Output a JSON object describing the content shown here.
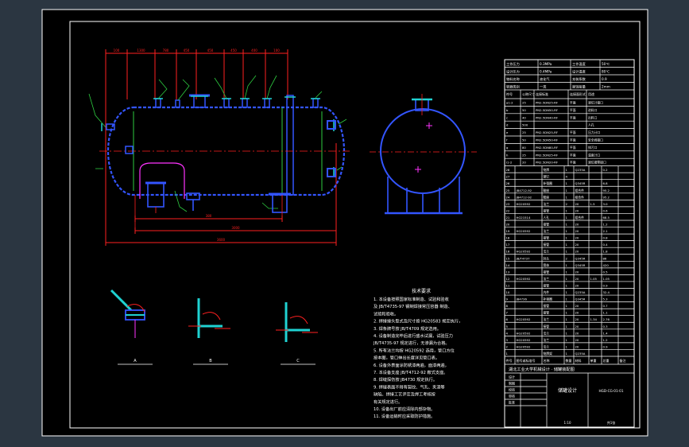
{
  "colors": {
    "viewport_bg": "#2b3641",
    "sheet_bg": "#000000",
    "frame": "#ffffff",
    "vessel": "#3355ff",
    "dimension": "#ff2020",
    "nozzle": "#1fd2d2",
    "leader": "#2ecc40",
    "magenta": "#ff33ff",
    "text": "#ffffff"
  },
  "drawing": {
    "plan_dims": [
      "100",
      "1300",
      "780",
      "450",
      "450",
      "450",
      "400",
      "100"
    ],
    "plan_bottom_dims": [
      "380",
      "3000",
      "3600"
    ],
    "detail_captions": [
      "A",
      "B",
      "C"
    ],
    "detail_titles": [
      "",
      "",
      ""
    ]
  },
  "notes": {
    "title": "技术要求",
    "lines": [
      "1. 本设备按照国家标准制造、试验和验收",
      "及 JB/T4735-97 钢制焊接常压容器 制造、",
      "试验和验收。",
      "2. 焊接接头型式及尺寸按 HG20583 规定执行，",
      "3. 焊条牌号按 JB/T4709 规定选用。",
      "4. 设备制造完毕后进行盛水试漏，试验压力",
      "JB/T4735-97 规定进行，无渗漏为合格。",
      "5. 所有法兰均按 HG20592 选用，管口方位",
      "按本图，管口伸出长度详见管口表。",
      "6. 设备外表面涂防锈漆两遍，面漆两遍，",
      "7. 本设备支座 JB/T4712-92 鞍式支座。",
      "8. 焊缝探伤按 JB4730 规定执行。",
      "9. 焊缝表面不得有裂纹、气孔、夹渣等",
      "缺陷。焊接工艺评定及焊工考核按",
      "有关规定进行。",
      "10. 设备出厂前应清除内部杂物。",
      "11. 设备运输时应采取防护措施。"
    ]
  },
  "spec_table": {
    "rows": [
      [
        "工作压力",
        "0.3MPa",
        "工作温度",
        "50℃"
      ],
      [
        "设计压力",
        "0.4MPa",
        "设计温度",
        "80℃"
      ],
      [
        "物料名称",
        "液化气",
        "充装系数",
        "0.9"
      ],
      [
        "容器类别",
        "一类",
        "腐蚀裕量",
        "2mm"
      ]
    ]
  },
  "nozzle_table": {
    "headers": [
      "符号",
      "公称尺寸",
      "连接标准",
      "连接面形式",
      "用途"
    ],
    "rows": [
      [
        "a1-2",
        "25",
        "PN2.5DN25-RF",
        "平面",
        "液位计接口"
      ],
      [
        "b",
        "50",
        "PN2.5DN50-RF",
        "平面",
        "进料口"
      ],
      [
        "c",
        "40",
        "PN2.5DN40-RF",
        "平面",
        "出料口"
      ],
      [
        "d",
        "500",
        "",
        "",
        "人孔"
      ],
      [
        "e",
        "25",
        "PN2.5DN25-RF",
        "平面",
        "压力计口"
      ],
      [
        "f",
        "50",
        "PN2.5DN50-RF",
        "平面",
        "安全阀接口"
      ],
      [
        "g",
        "80",
        "PN2.5DN80-RF",
        "平面",
        "排污口"
      ],
      [
        "h",
        "25",
        "PN2.5DN25-RF",
        "平面",
        "温度计口"
      ],
      [
        "i1-2",
        "20",
        "PN2.5DN20-RF",
        "平面",
        "液位报警接口"
      ]
    ]
  },
  "bom": {
    "rows": [
      [
        "28",
        "",
        "铭牌",
        "1",
        "Q235A",
        "",
        "0.2",
        ""
      ],
      [
        "27",
        "",
        "铆钉",
        "4",
        "",
        "",
        "",
        ""
      ],
      [
        "26",
        "",
        "补强圈",
        "1",
        "Q345R",
        "",
        "6.8",
        ""
      ],
      [
        "25",
        "JB4712-92",
        "鞍座",
        "1",
        "组合件",
        "",
        "95.2",
        ""
      ],
      [
        "24",
        "JB4712-92",
        "鞍座",
        "1",
        "组合件",
        "",
        "95.2",
        ""
      ],
      [
        "23",
        "HG20592",
        "法兰",
        "2",
        "20",
        "1.5",
        "3.0",
        ""
      ],
      [
        "22",
        "",
        "接管",
        "1",
        "20",
        "",
        "0.6",
        ""
      ],
      [
        "21",
        "HG21514",
        "人孔",
        "1",
        "组合件",
        "",
        "68.5",
        ""
      ],
      [
        "20",
        "",
        "接管",
        "1",
        "20",
        "",
        "1.2",
        ""
      ],
      [
        "19",
        "HG20592",
        "法兰",
        "1",
        "20",
        "",
        "2.1",
        ""
      ],
      [
        "18",
        "",
        "接管",
        "1",
        "20",
        "",
        "0.8",
        ""
      ],
      [
        "17",
        "",
        "接管",
        "1",
        "20",
        "",
        "0.4",
        ""
      ],
      [
        "16",
        "HG20592",
        "法兰",
        "1",
        "20",
        "",
        "1.8",
        ""
      ],
      [
        "15",
        "JB/T4737",
        "封头",
        "2",
        "Q345R",
        "",
        "86",
        ""
      ],
      [
        "14",
        "",
        "筒体",
        "1",
        "Q345R",
        "",
        "420",
        ""
      ],
      [
        "13",
        "",
        "接管",
        "1",
        "20",
        "",
        "0.5",
        ""
      ],
      [
        "12",
        "HG20592",
        "法兰",
        "1",
        "20",
        "1.05",
        "1.05",
        ""
      ],
      [
        "11",
        "",
        "接管",
        "1",
        "20",
        "",
        "0.9",
        ""
      ],
      [
        "10",
        "",
        "内件",
        "1",
        "Q235A",
        "",
        "32.4",
        ""
      ],
      [
        "9",
        "JB4736",
        "补强圈",
        "1",
        "Q345R",
        "",
        "5.3",
        ""
      ],
      [
        "8",
        "",
        "接管",
        "1",
        "20",
        "",
        "0.7",
        ""
      ],
      [
        "7",
        "",
        "接管",
        "1",
        "20",
        "",
        "1.1",
        ""
      ],
      [
        "6",
        "HG20592",
        "法兰",
        "1",
        "20",
        "1.34",
        "2.76",
        ""
      ],
      [
        "5",
        "",
        "接管",
        "1",
        "20",
        "",
        "0.3",
        ""
      ],
      [
        "4",
        "HG20592",
        "法兰",
        "1",
        "20",
        "",
        "1.4",
        ""
      ],
      [
        "3",
        "HG20592",
        "法兰",
        "1",
        "20",
        "",
        "1.2",
        ""
      ],
      [
        "2",
        "HG20592",
        "法兰",
        "1",
        "20",
        "",
        "0.9",
        ""
      ],
      [
        "1",
        "",
        "铭牌架",
        "1",
        "Q235A",
        "",
        "",
        ""
      ]
    ],
    "headers": [
      "件号",
      "图号或标准号",
      "名称",
      "数量",
      "材料",
      "单重",
      "总重",
      "备注"
    ]
  },
  "title_block": {
    "school": "湖北工业大学机械设计 · 储罐装配图",
    "drawing_name": "储罐设计",
    "drawing_no": "HGD-CG-01-01",
    "sign_rows": [
      [
        "设计",
        ""
      ],
      [
        "制图",
        ""
      ],
      [
        "校核",
        ""
      ],
      [
        "审核",
        ""
      ],
      [
        "批准",
        ""
      ]
    ],
    "scale": "1:10",
    "sheet": "共1张"
  }
}
